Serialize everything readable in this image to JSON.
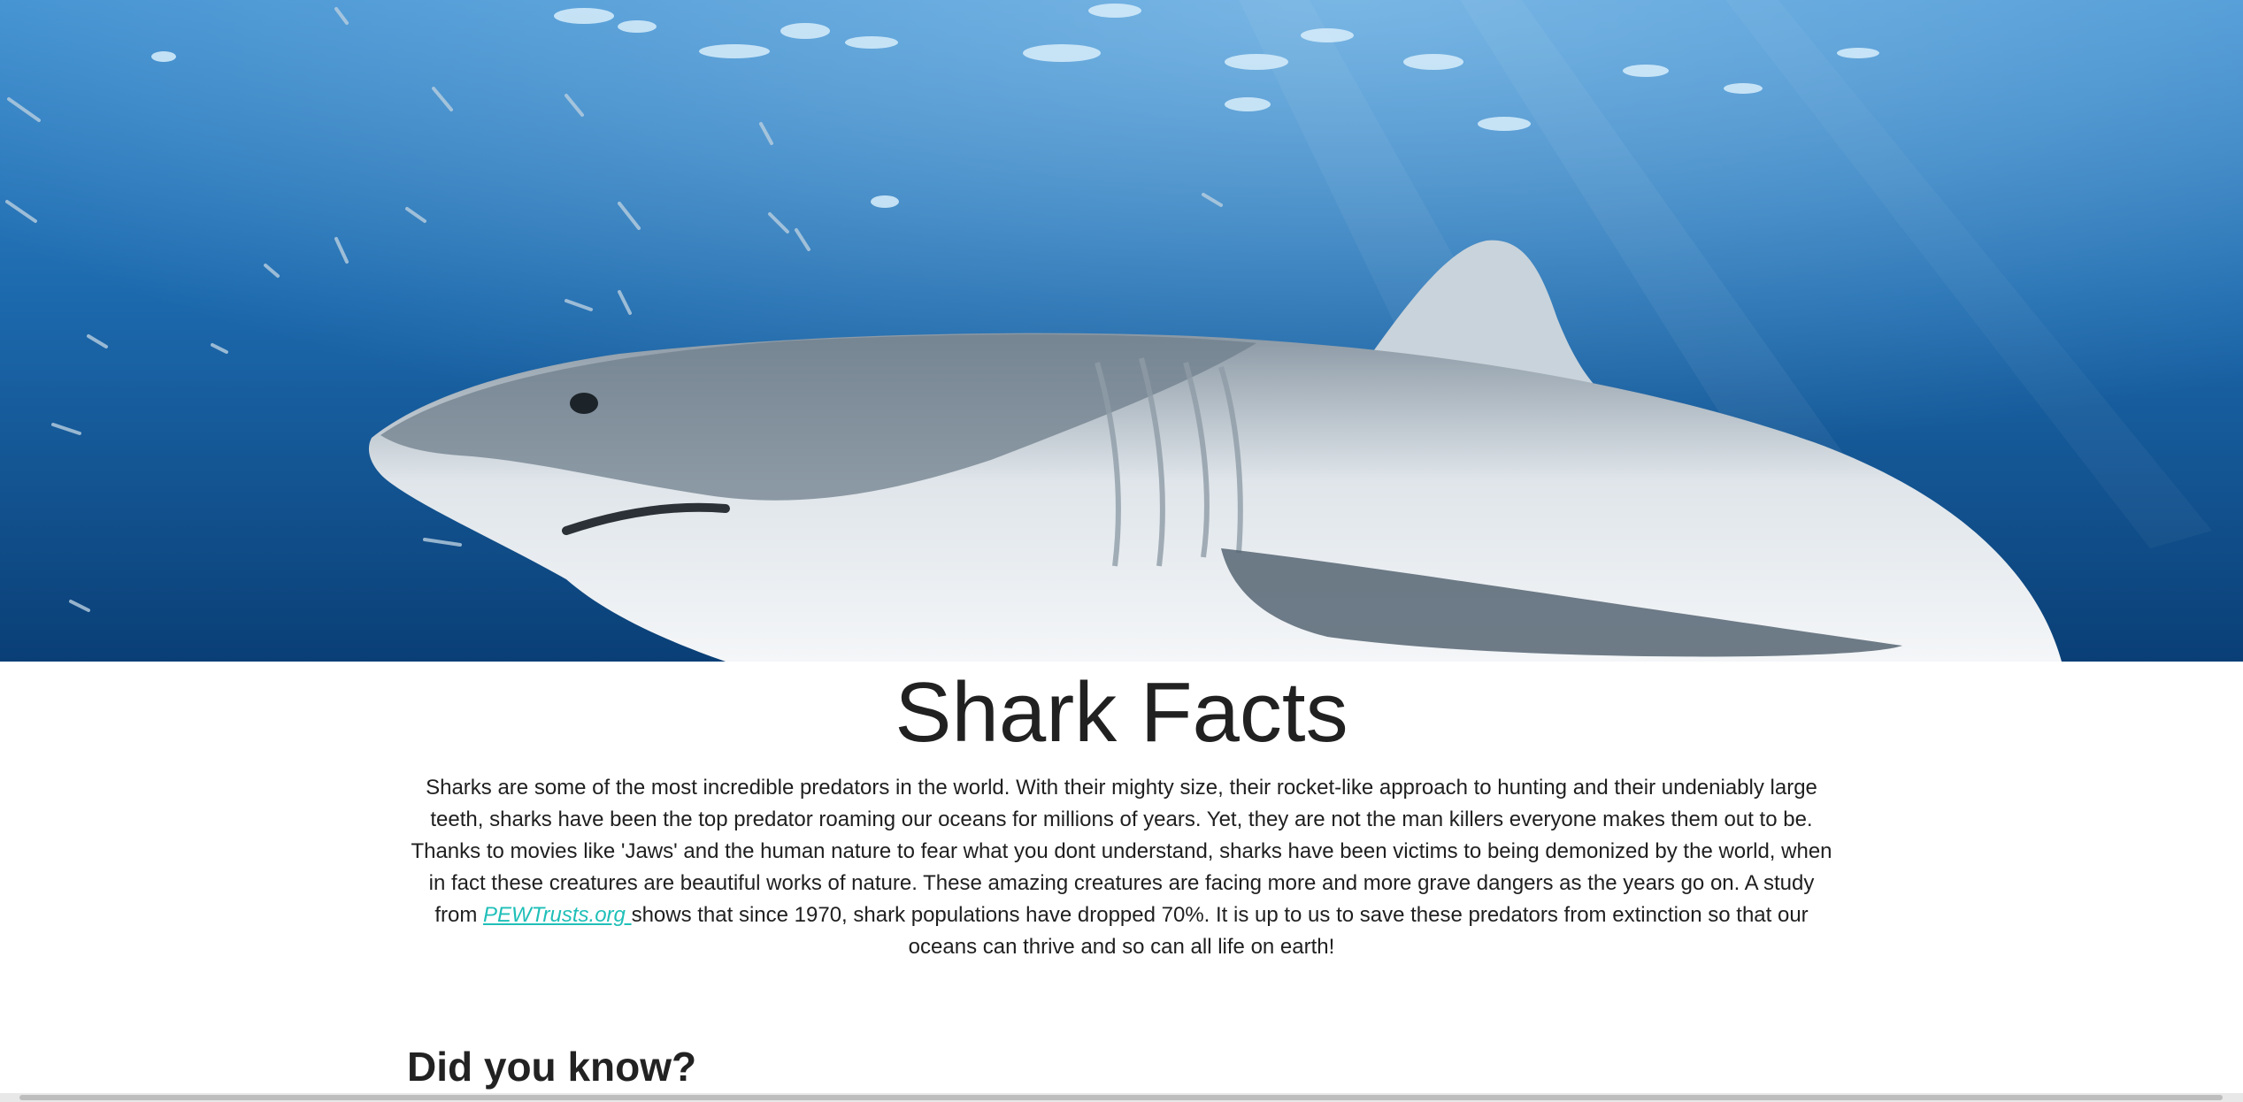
{
  "hero": {
    "image_icon": "shark-photo",
    "colors": {
      "deep": "#0b4a86",
      "surface": "#3d8ccb",
      "shark": "#dfe4e8"
    }
  },
  "title": "Shark Facts",
  "intro": {
    "text_before": "Sharks are some of the most incredible predators in the world. With their mighty size, their rocket-like approach to hunting and their undeniably large teeth, sharks have been the top predator roaming our oceans for millions of years. Yet, they are not the man killers everyone makes them out to be. Thanks to movies like 'Jaws' and the human nature to fear what you dont understand, sharks have been victims to being demonized by the world, when in fact these creatures are beautiful works of nature. These amazing creatures are facing more and more grave dangers as the years go on. A study from ",
    "link_text": "PEWTrusts.org ",
    "text_after": "shows that since 1970, shark populations have dropped 70%. It is up to us to save these predators from extinction so that our oceans can thrive and so can all life on earth!",
    "link_color": "#1fbfb8"
  },
  "section_heading": "Did you know?"
}
